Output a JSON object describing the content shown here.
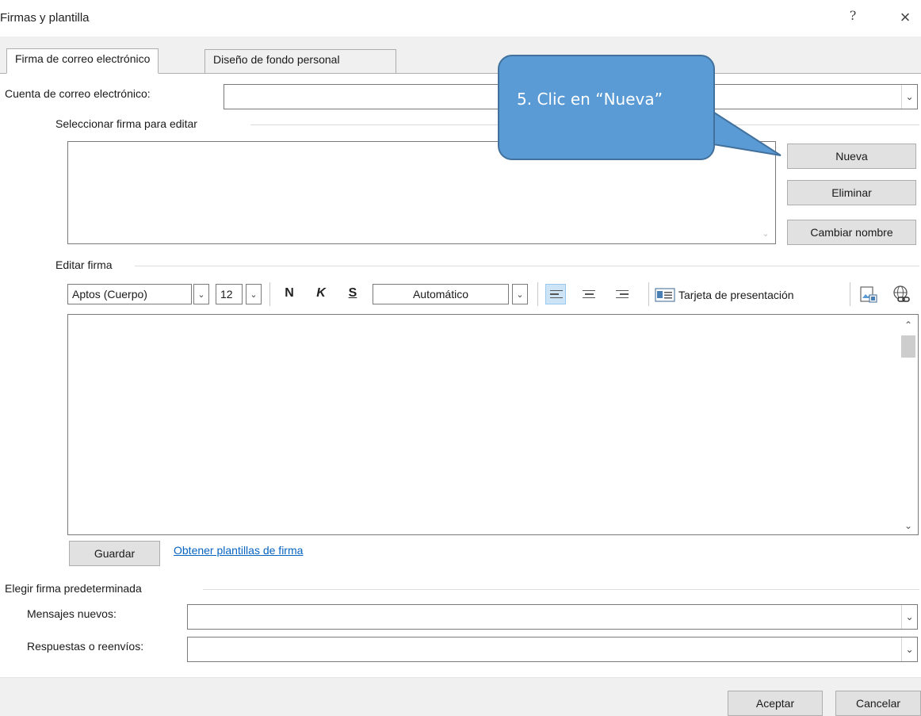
{
  "window": {
    "title": "Firmas y plantilla",
    "help": "?",
    "close": "×"
  },
  "tabs": [
    {
      "label": "Firma de correo electrónico",
      "active": true
    },
    {
      "label": "Diseño de fondo personal",
      "active": false
    }
  ],
  "account": {
    "label": "Cuenta de correo electrónico:",
    "value": ""
  },
  "select_signature": {
    "group_label": "Seleccionar firma para editar",
    "buttons": {
      "new": "Nueva",
      "delete": "Eliminar",
      "rename": "Cambiar nombre"
    }
  },
  "edit_signature": {
    "group_label": "Editar firma",
    "font": "Aptos (Cuerpo)",
    "size": "12",
    "bold": "N",
    "italic": "K",
    "underline": "S",
    "color": "Automático",
    "business_card": "Tarjeta de presentación",
    "save": "Guardar",
    "templates_link": "Obtener plantillas de firma"
  },
  "default_signature": {
    "group_label": "Elegir firma predeterminada",
    "new_messages_label": "Mensajes nuevos:",
    "new_messages_value": "",
    "replies_label": "Respuestas o reenvíos:",
    "replies_value": ""
  },
  "footer": {
    "ok": "Aceptar",
    "cancel": "Cancelar"
  },
  "callout": {
    "text": "5. Clic en “Nueva”",
    "fill": "#5b9bd5"
  },
  "colors": {
    "link": "#0563c1",
    "accent": "#5b9bd5"
  }
}
